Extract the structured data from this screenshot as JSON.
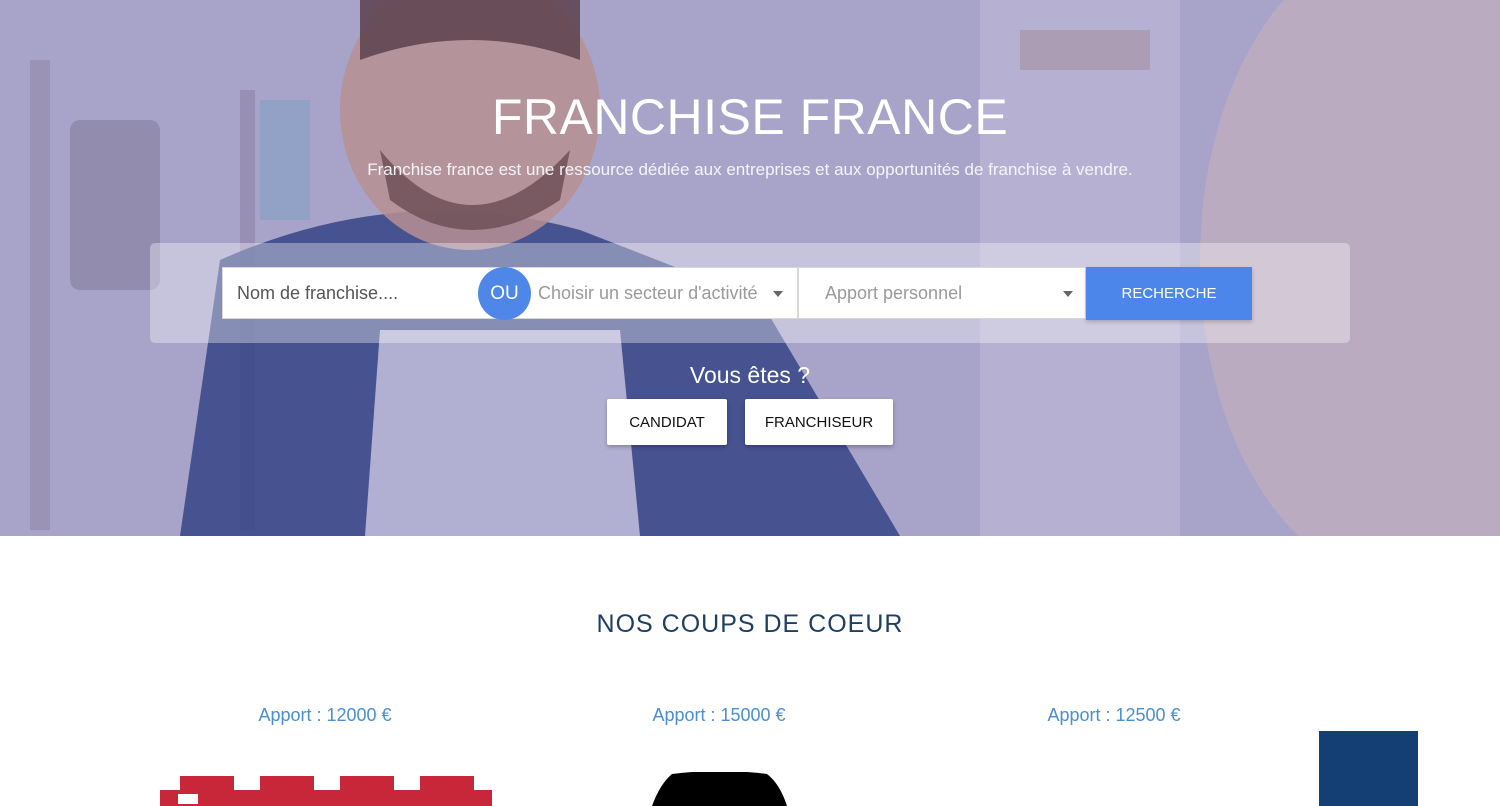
{
  "hero": {
    "title": "FRANCHISE FRANCE",
    "subtitle": "Franchise france est une ressource dédiée aux entreprises et aux opportunités de franchise à vendre."
  },
  "search": {
    "name_placeholder": "Nom de franchise....",
    "ou_label": "OU",
    "sector_selected": "Choisir un secteur d'activité",
    "apport_selected": "Apport personnel",
    "search_label": "RECHERCHE"
  },
  "role": {
    "question": "Vous êtes ?",
    "candidat_label": "CANDIDAT",
    "franchiseur_label": "FRANCHISEUR"
  },
  "featured": {
    "title": "NOS COUPS DE COEUR",
    "items": [
      {
        "apport": "Apport : 12000 €"
      },
      {
        "apport": "Apport : 15000 €"
      },
      {
        "apport": "Apport : 12500 €"
      }
    ]
  },
  "colors": {
    "accent": "#4d86ea",
    "heading": "#1e3f63",
    "link": "#4b8fcf",
    "brand_square": "#133f75"
  }
}
